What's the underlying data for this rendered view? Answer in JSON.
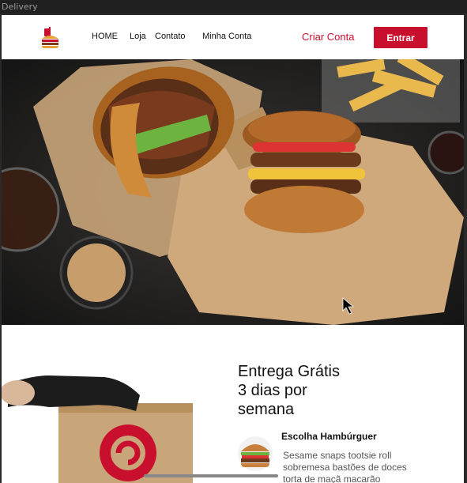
{
  "window": {
    "title": "Delivery"
  },
  "nav": {
    "links": [
      "HOME",
      "Loja",
      "Contato",
      "Minha Conta"
    ],
    "signup_label": "Criar Conta",
    "login_label": "Entrar"
  },
  "promo": {
    "title_lines": [
      "Entrega Grátis",
      "3 dias por",
      "semana"
    ]
  },
  "feature": {
    "title": "Escolha Hambúrguer",
    "description_lines": [
      "Sesame snaps tootsie roll",
      "sobremesa bastões de doces",
      "torta de maçã macarão"
    ]
  },
  "colors": {
    "brand": "#c8102e",
    "accent": "#e8a23a"
  },
  "icons": {
    "logo": "burger-drink-logo",
    "feature": "burger-icon",
    "cursor": "mouse-pointer"
  }
}
